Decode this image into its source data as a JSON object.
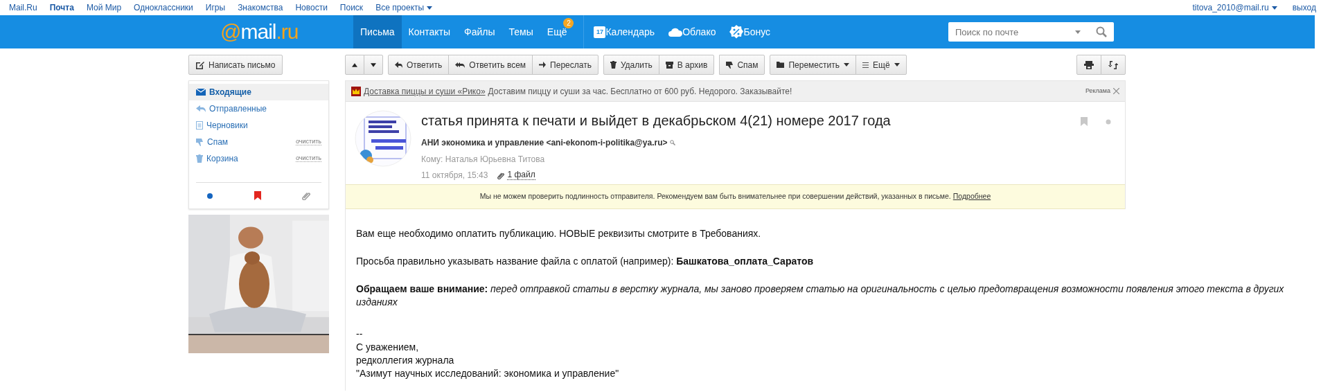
{
  "top_links": [
    {
      "label": "Mail.Ru",
      "selected": false
    },
    {
      "label": "Почта",
      "selected": true
    },
    {
      "label": "Мой Мир",
      "selected": false
    },
    {
      "label": "Одноклассники",
      "selected": false
    },
    {
      "label": "Игры",
      "selected": false
    },
    {
      "label": "Знакомства",
      "selected": false
    },
    {
      "label": "Новости",
      "selected": false
    },
    {
      "label": "Поиск",
      "selected": false
    }
  ],
  "projects_menu": "Все проекты",
  "user": {
    "email": "titova_2010@mail.ru",
    "logout": "выход"
  },
  "logo": {
    "at": "@",
    "name": "mail",
    "tld": ".ru"
  },
  "nav_tabs": [
    {
      "label": "Письма",
      "selected": true
    },
    {
      "label": "Контакты",
      "selected": false
    },
    {
      "label": "Файлы",
      "selected": false
    },
    {
      "label": "Темы",
      "selected": false
    },
    {
      "label": "Ещё",
      "selected": false,
      "badge": "2"
    }
  ],
  "services": [
    {
      "label": "Календарь",
      "kind": "calendar",
      "icon_text": "17"
    },
    {
      "label": "Облако",
      "kind": "cloud"
    },
    {
      "label": "Бонус",
      "kind": "bonus"
    }
  ],
  "search": {
    "placeholder": "Поиск по почте"
  },
  "compose_button": "Написать письмо",
  "toolbar": [
    {
      "buttons": [
        {
          "kind": "up"
        },
        {
          "kind": "down"
        }
      ]
    },
    {
      "buttons": [
        {
          "kind": "reply",
          "label": "Ответить"
        },
        {
          "kind": "reply_all",
          "label": "Ответить всем"
        },
        {
          "kind": "forward",
          "label": "Переслать"
        }
      ]
    },
    {
      "buttons": [
        {
          "kind": "delete",
          "label": "Удалить"
        },
        {
          "kind": "archive",
          "label": "В архив"
        }
      ]
    },
    {
      "buttons": [
        {
          "kind": "spam",
          "label": "Спам"
        }
      ]
    },
    {
      "buttons": [
        {
          "kind": "move",
          "label": "Переместить",
          "dropdown": true
        },
        {
          "kind": "more",
          "label": "Ещё",
          "dropdown": true
        }
      ]
    }
  ],
  "toolbar_right": [
    {
      "kind": "template"
    },
    {
      "kind": "swap"
    }
  ],
  "folders": [
    {
      "label": "Входящие",
      "kind": "inbox",
      "selected": true
    },
    {
      "label": "Отправленные",
      "kind": "sent",
      "selected": false
    },
    {
      "label": "Черновики",
      "kind": "drafts",
      "selected": false
    },
    {
      "label": "Спам",
      "kind": "spam",
      "selected": false,
      "action": "очистить"
    },
    {
      "label": "Корзина",
      "kind": "trash",
      "selected": false,
      "action": "очистить"
    }
  ],
  "filters": [
    {
      "kind": "unread"
    },
    {
      "kind": "flagged"
    },
    {
      "kind": "attachments"
    }
  ],
  "ad": {
    "link": "Доставка пиццы и суши «Рико»",
    "text": "Доставим пиццу и суши за час. Бесплатно от 600 руб. Недорого. Заказывайте!",
    "label": "Реклама"
  },
  "message": {
    "subject": "статья принята к печати и выйдет в декабрьском 4(21) номере 2017 года",
    "sender": "АНИ экономика и управление <ani-ekonom-i-politika@ya.ru>",
    "to": "Кому: Наталья Юрьевна Титова",
    "date": "11 октября, 15:43",
    "attachments": "1 файл",
    "flagged": false,
    "unread": false
  },
  "warning": {
    "text": "Мы не можем проверить подлинность отправителя. Рекомендуем вам быть внимательнее при совершении действий, указанных в письме.",
    "link": "Подробнее"
  },
  "body": [
    {
      "kind": "paragraph",
      "text": "Вам еще необходимо оплатить публикацию. НОВЫЕ реквизиты смотрите в Требованиях."
    },
    {
      "kind": "paragraph",
      "text": "Просьба правильно указывать название файла с оплатой (например): **Башкатова_оплата_Саратов**"
    },
    {
      "kind": "paragraph",
      "text": "**Обращаем ваше внимание:** *перед отправкой статьи в верстку журнала, мы заново проверяем статью на оригинальность с целью предотвращения возможности появления этого текста в других изданиях*"
    },
    {
      "kind": "signature",
      "lines": [
        "--",
        "С уважением,",
        "редколлегия журнала",
        "\"Азимут научных исследований: экономика и управление\""
      ]
    }
  ]
}
